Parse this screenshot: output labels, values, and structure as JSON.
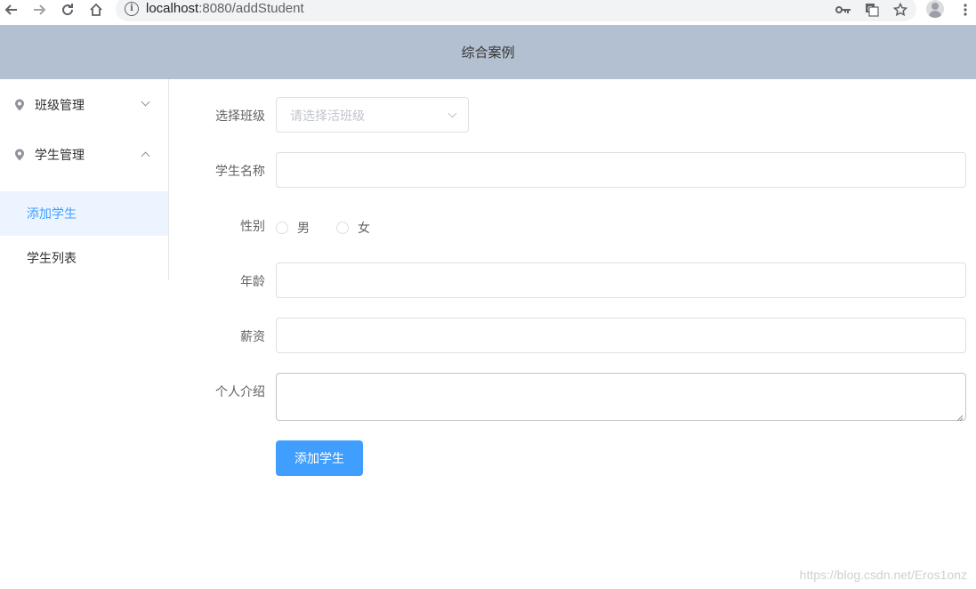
{
  "browser": {
    "url_host": "localhost",
    "url_path": ":8080/addStudent",
    "icons": {
      "back": "back-arrow-icon",
      "forward": "forward-arrow-icon",
      "reload": "reload-icon",
      "home": "home-icon",
      "info": "info-icon",
      "key": "key-icon",
      "translate": "translate-icon",
      "star": "star-icon",
      "profile": "profile-icon",
      "menu": "kebab-menu-icon"
    }
  },
  "header": {
    "title": "综合案例",
    "background": "#b3c0d1"
  },
  "sidebar": {
    "groups": [
      {
        "label": "班级管理",
        "expanded": false,
        "icon": "location-pin-icon"
      },
      {
        "label": "学生管理",
        "expanded": true,
        "icon": "location-pin-icon"
      }
    ],
    "items": [
      {
        "label": "添加学生",
        "active": true
      },
      {
        "label": "学生列表",
        "active": false
      }
    ]
  },
  "form": {
    "class_label": "选择班级",
    "class_placeholder": "请选择活班级",
    "name_label": "学生名称",
    "name_value": "",
    "gender_label": "性别",
    "gender_options": [
      "男",
      "女"
    ],
    "age_label": "年龄",
    "age_value": "",
    "salary_label": "薪资",
    "salary_value": "",
    "intro_label": "个人介绍",
    "intro_value": "",
    "submit_label": "添加学生"
  },
  "colors": {
    "primary": "#409eff",
    "active_bg": "#ecf5ff",
    "border": "#dcdfe6"
  },
  "watermark": "https://blog.csdn.net/Eros1onz"
}
